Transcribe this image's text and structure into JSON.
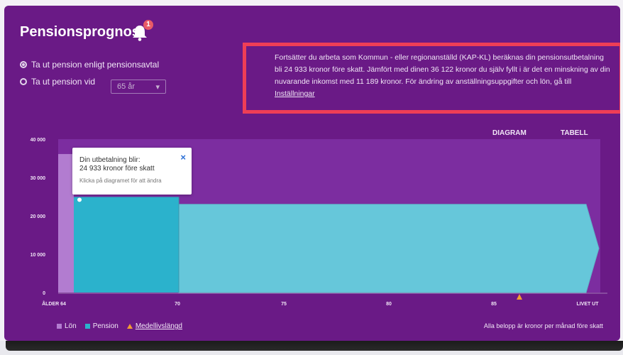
{
  "header": {
    "title": "Pensionsprognos",
    "badge_count": "1"
  },
  "options": {
    "radio1_label": "Ta ut pension enligt pensionsavtal",
    "radio2_label": "Ta ut pension vid",
    "age_select_value": "65 år"
  },
  "info_box": {
    "text": "Fortsätter du arbeta som Kommun - eller regionanställd (KAP-KL) beräknas din pensionsutbetalning bli 24 933 kronor före skatt. Jämfört med dinen 36 122 kronor du själv fyllt i är det en minskning av din nuvarande inkomst med 11 189 kronor. För ändring av anställningsuppgifter och lön, gå till",
    "link": "Inställningar"
  },
  "view_tabs": [
    {
      "label": "DIAGRAM",
      "active": true
    },
    {
      "label": "TABELL",
      "active": false
    }
  ],
  "tooltip": {
    "line1": "Din utbetalning blir:",
    "line2": "24 933 kronor före skatt",
    "line3": "Klicka på diagramet för att ändra",
    "close": "×"
  },
  "legend": {
    "items": [
      {
        "label": "Lön",
        "color": "#b27cd0"
      },
      {
        "label": "Pension",
        "color": "#2bb2cc"
      },
      {
        "label": "Medellivslängd",
        "color": "#f39c33"
      }
    ],
    "note": "Alla belopp är kronor per månad före skatt"
  },
  "colors": {
    "panel_bg": "#6a1a86",
    "plot_bg": "#7c2da0",
    "salary": "#b27cd0",
    "pension_early": "#2bb2cc",
    "pension_later": "#66c7da",
    "accent": "#ef3e56"
  },
  "chart_data": {
    "type": "area",
    "x_ticks": [
      "ÅLDER 64",
      "70",
      "75",
      "80",
      "85",
      "LIVET UT"
    ],
    "y_ticks": [
      "40 000",
      "30 000",
      "20 000",
      "10 000",
      "0"
    ],
    "ylim": [
      0,
      40000
    ],
    "series": [
      {
        "name": "Lön",
        "segment": "age 64 – 65",
        "value": 36122
      },
      {
        "name": "Pension",
        "segment": "age 65 – 70",
        "value": 24933
      },
      {
        "name": "Pension",
        "segment": "age 70 – livet ut",
        "value": 23000
      }
    ],
    "marker": {
      "name": "Medellivslängd",
      "at": "age ~86"
    },
    "legend": "bottom-left",
    "grid": false
  }
}
